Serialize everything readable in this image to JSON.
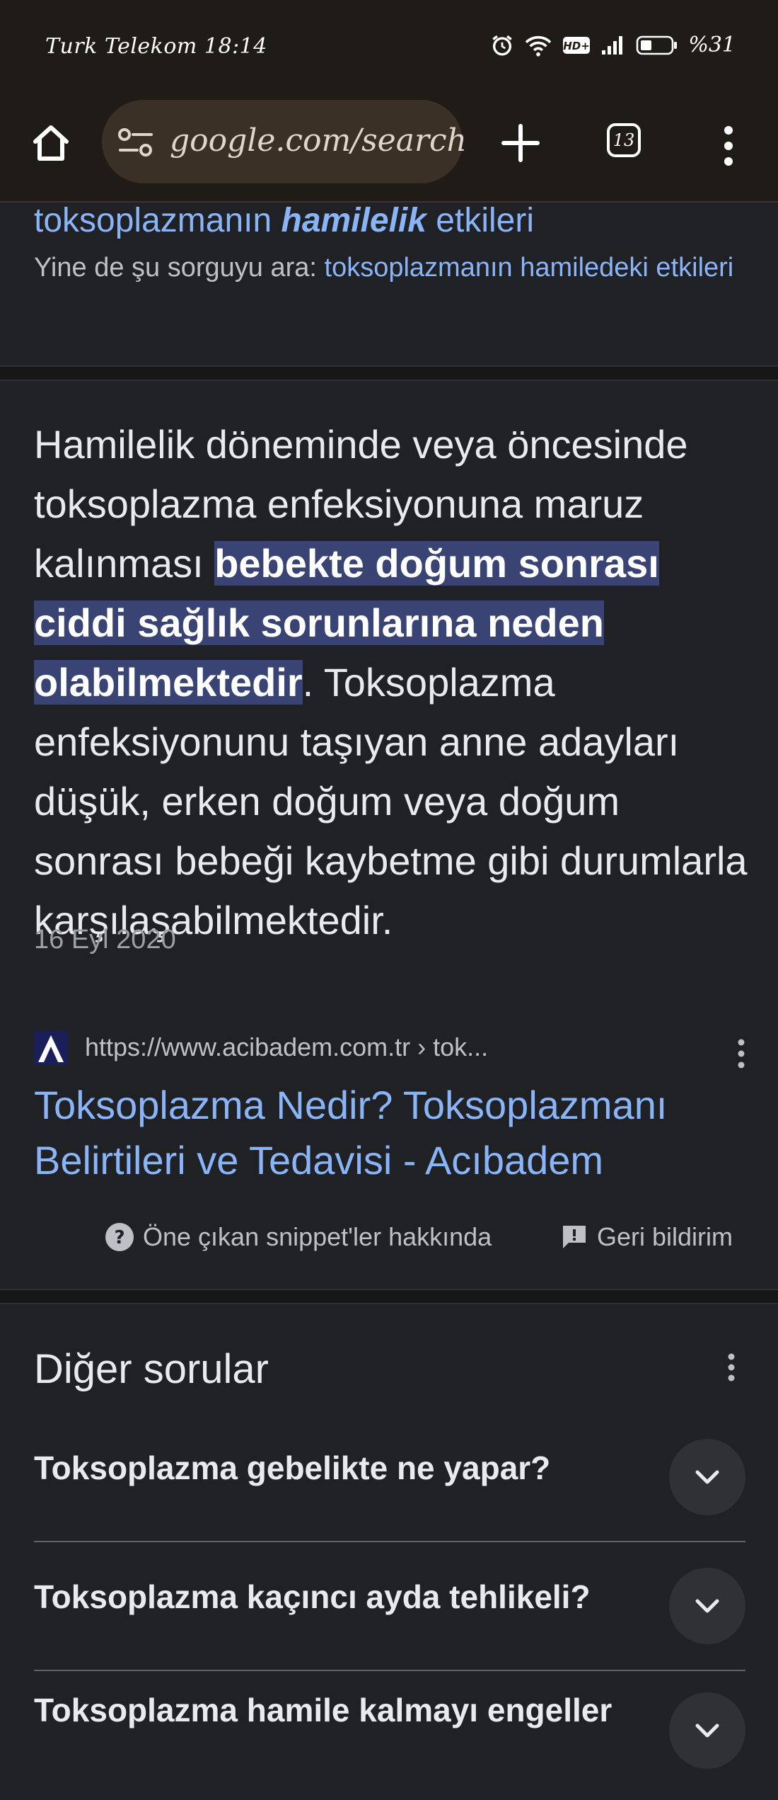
{
  "status_bar": {
    "carrier_time": "Turk Telekom 18:14",
    "battery": "%31",
    "icons": [
      "alarm-icon",
      "wifi-icon",
      "hd-icon",
      "signal-icon",
      "battery-icon"
    ]
  },
  "toolbar": {
    "url": "google.com/search",
    "tab_count": "13"
  },
  "suggestion": {
    "title_before": "toksoplazmanın ",
    "title_bold": "hamilelik",
    "title_after": " etkileri",
    "prefix": "Yine de şu sorguyu ara: ",
    "link": "toksoplazmanın hamiledeki etkileri"
  },
  "snippet": {
    "text_before": "Hamilelik döneminde veya öncesinde toksoplazma enfeksiyonuna maruz kalınması ",
    "highlight": "bebekte doğum sonrası ciddi sağlık sorunlarına neden olabilmektedir",
    "text_after": ". Toksoplazma enfeksiyonunu taşıyan anne adayları düşük, erken doğum veya doğum sonrası bebeği kaybetme gibi durumlarla karşılaşabilmektedir.",
    "date": "16 Eyl 2020"
  },
  "source": {
    "url": "https://www.acibadem.com.tr › tok...",
    "title": "Toksoplazma Nedir? Toksoplazmanı Belirtileri ve Tedavisi - Acıbadem"
  },
  "footer_links": {
    "about": "Öne çıkan snippet'ler hakkında",
    "feedback": "Geri bildirim"
  },
  "paa": {
    "title": "Diğer sorular",
    "questions": [
      "Toksoplazma gebelikte ne yapar?",
      "Toksoplazma kaçıncı ayda tehlikeli?",
      "Toksoplazma hamile kalmayı engeller"
    ]
  },
  "colors": {
    "background": "#202124",
    "link": "#8ab4f8",
    "highlight": "#394374",
    "toolbar": "#1f1b16"
  }
}
